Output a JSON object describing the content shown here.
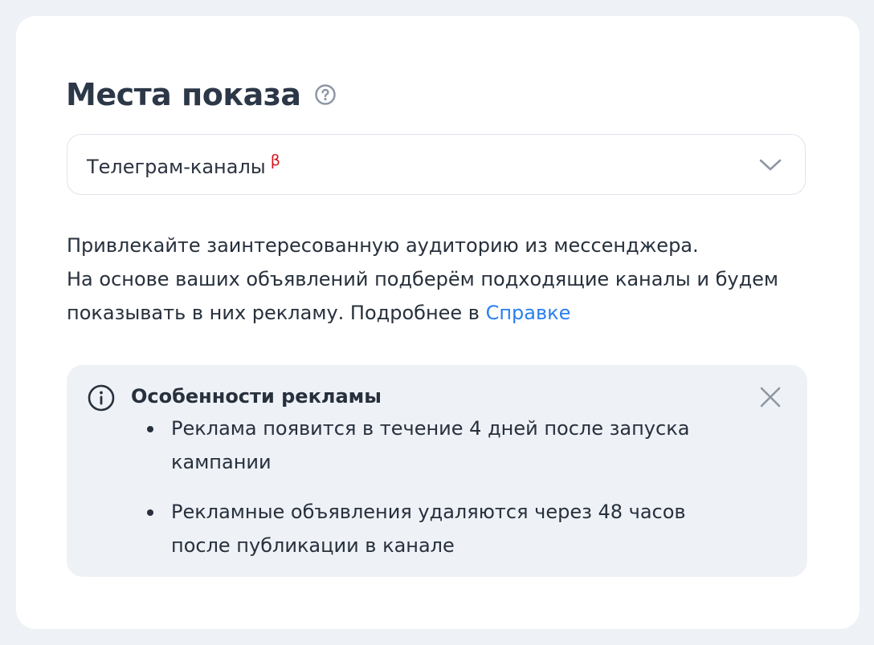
{
  "header": {
    "title": "Места показа",
    "help_icon": "question-circle-icon"
  },
  "placement_select": {
    "value": "Телеграм-каналы",
    "badge": "β",
    "badge_color": "#d9121b",
    "chevron_icon": "chevron-down-icon"
  },
  "description": {
    "line1": "Привлекайте заинтересованную аудиторию из мессенджера.",
    "line2": "На основе ваших объявлений подберём подходящие каналы и будем",
    "line3": "показывать в них рекламу. Подробнее в ",
    "link": "Справке",
    "link_color": "#2a7ff0"
  },
  "notice": {
    "title": "Особенности рекламы",
    "info_icon": "info-circle-icon",
    "close_icon": "close-icon",
    "items": [
      {
        "line1": "Реклама появится в течение 4 дней после запуска",
        "line2": "кампании"
      },
      {
        "line1": "Рекламные объявления удаляются через 48 часов",
        "line2": "после публикации в канале"
      }
    ]
  }
}
